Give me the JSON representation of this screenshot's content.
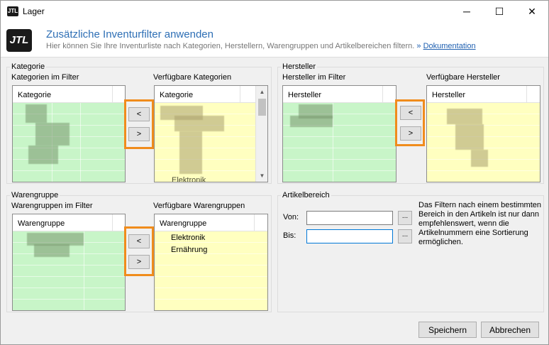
{
  "window": {
    "title": "Lager",
    "icon_text": "JTL",
    "controls": {
      "minimize": "─",
      "maximize": "☐",
      "close": "✕"
    }
  },
  "header": {
    "logo_text": "JTL",
    "title": "Zusätzliche Inventurfilter anwenden",
    "subtitle": "Hier können Sie Ihre Inventurliste nach Kategorien, Herstellern, Warengruppen und Artikelbereichen filtern.",
    "link_prefix": "»",
    "link_label": "Dokumentation"
  },
  "kategorie": {
    "legend": "Kategorie",
    "left_label": "Kategorien im Filter",
    "left_column": "Kategorie",
    "right_label": "Verfügbare Kategorien",
    "right_column": "Kategorie",
    "right_partial_item": "Elektronik",
    "btn_left": "<",
    "btn_right": ">"
  },
  "hersteller": {
    "legend": "Hersteller",
    "left_label": "Hersteller im Filter",
    "left_column": "Hersteller",
    "right_label": "Verfügbare Hersteller",
    "right_column": "Hersteller",
    "btn_left": "<",
    "btn_right": ">"
  },
  "warengruppe": {
    "legend": "Warengruppe",
    "left_label": "Warengruppen im Filter",
    "left_column": "Warengruppe",
    "right_label": "Verfügbare Warengruppen",
    "right_column": "Warengruppe",
    "right_items": [
      "Elektronik",
      "Ernährung"
    ],
    "btn_left": "<",
    "btn_right": ">"
  },
  "artikelbereich": {
    "legend": "Artikelbereich",
    "von_label": "Von:",
    "bis_label": "Bis:",
    "von_value": "",
    "bis_value": "",
    "browse_label": "...",
    "note": "Das Filtern nach einem bestimmten Bereich in den Artikeln ist nur dann empfehlenswert, wenn die Artikelnummern eine Sortierung ermöglichen."
  },
  "footer": {
    "save_label": "Speichern",
    "cancel_label": "Abbrechen"
  },
  "colors": {
    "highlight": "#f08c1c",
    "list_green": "#c8f5c8",
    "list_yellow": "#ffffc0",
    "title_blue": "#2e6fb5"
  }
}
